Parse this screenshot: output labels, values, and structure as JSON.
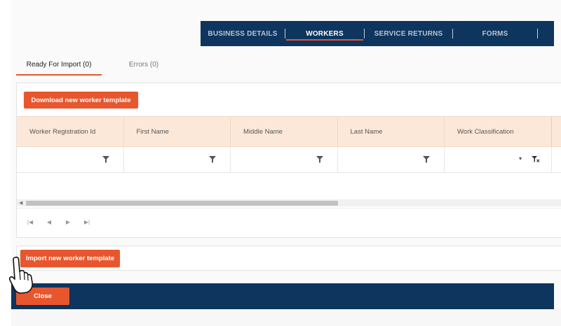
{
  "nav": {
    "tabs": [
      {
        "label": "BUSINESS DETAILS"
      },
      {
        "label": "WORKERS"
      },
      {
        "label": "SERVICE RETURNS"
      },
      {
        "label": "FORMS"
      }
    ],
    "active_tab": "WORKERS"
  },
  "subtabs": [
    {
      "label": "Ready For Import (0)"
    },
    {
      "label": "Errors (0)"
    }
  ],
  "grid": {
    "download_label": "Download new worker template",
    "columns": [
      {
        "label": "Worker Registration Id"
      },
      {
        "label": "First Name"
      },
      {
        "label": "Middle Name"
      },
      {
        "label": "Last Name"
      },
      {
        "label": "Work Classification"
      }
    ],
    "filter_icon": "funnel-icon",
    "pager_icons": [
      "first-page-icon",
      "prev-page-icon",
      "next-page-icon",
      "last-page-icon"
    ]
  },
  "import": {
    "button_label": "Import new worker template"
  },
  "footer": {
    "close_label": "Close"
  },
  "colors": {
    "navy": "#0d355e",
    "accent": "#e8562e",
    "header_bg": "#fce8d8"
  }
}
